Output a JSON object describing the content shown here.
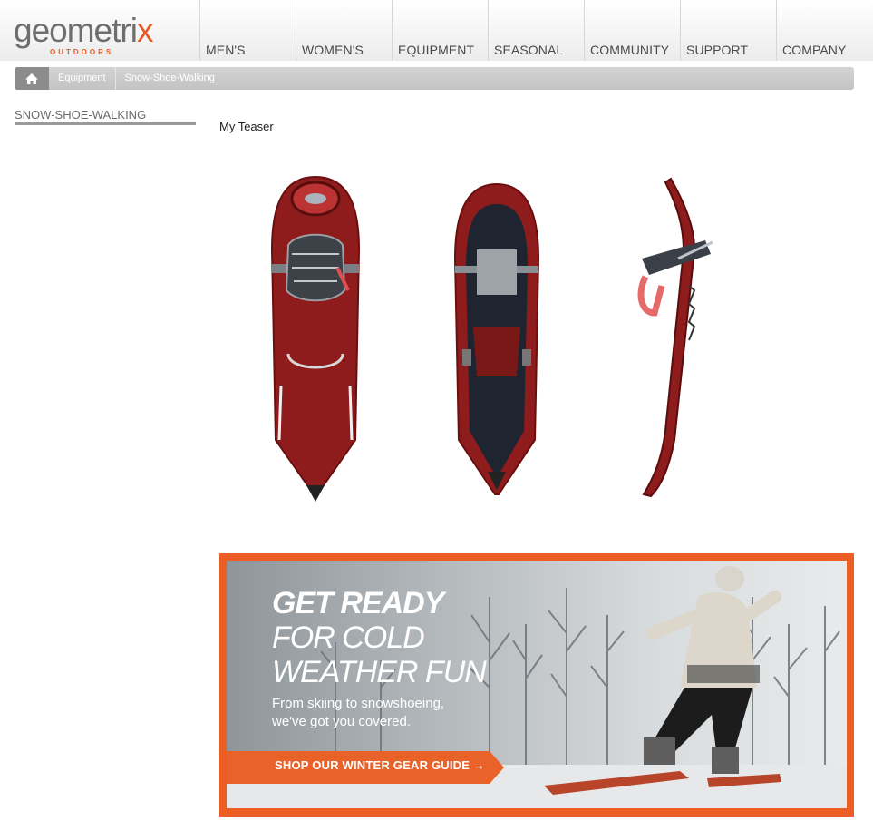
{
  "logo": {
    "word_main": "geometri",
    "word_x": "x",
    "tagline": "OUTDOORS",
    "accent_color": "#e35a25"
  },
  "nav": {
    "items": [
      "MEN'S",
      "WOMEN'S",
      "EQUIPMENT",
      "SEASONAL",
      "COMMUNITY",
      "SUPPORT",
      "COMPANY"
    ]
  },
  "breadcrumb": {
    "home_icon": "home-icon",
    "items": [
      "Equipment",
      "Snow-Shoe-Walking"
    ]
  },
  "sidebar": {
    "title": "SNOW-SHOE-WALKING"
  },
  "main": {
    "teaser_title": "My Teaser",
    "product_images": [
      "snowshoe-top-view",
      "snowshoe-bottom-view",
      "snowshoe-side-view"
    ],
    "product_color": "#9a1f1f"
  },
  "banner": {
    "headline1": "GET READY",
    "headline2": "FOR COLD",
    "headline3": "WEATHER FUN",
    "sub1": "From skiing to snowshoeing,",
    "sub2": "we've got you covered.",
    "cta": "SHOP OUR WINTER GEAR GUIDE →",
    "border_color": "#ec5f24"
  }
}
